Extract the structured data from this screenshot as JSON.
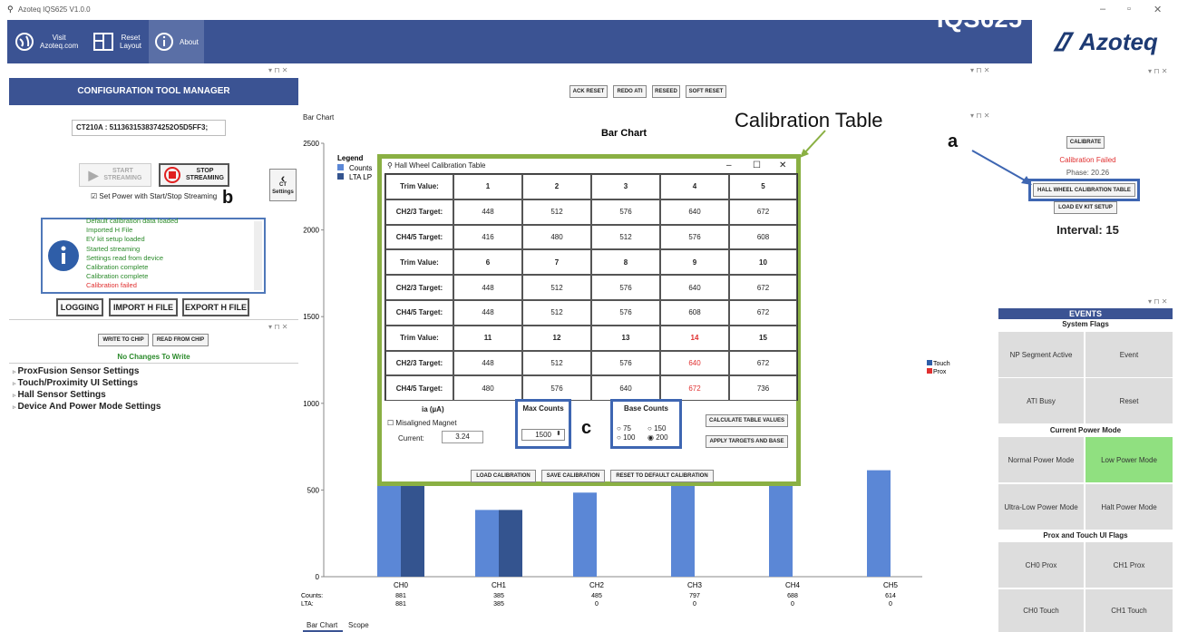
{
  "app": {
    "title": "Azoteq IQS625 V1.0.0",
    "brand": "IQS625",
    "logo": "Azoteq"
  },
  "ribbon": {
    "visit": "Visit\nAzoteq.com",
    "reset": "Reset\nLayout",
    "about": "About"
  },
  "config": {
    "header": "CONFIGURATION TOOL MANAGER",
    "device": "CT210A : 5113631538374252O5D5FF3;",
    "start": "START\nSTREAMING",
    "stop": "STOP\nSTREAMING",
    "power_chk": "Set Power with Start/Stop Streaming",
    "ct_settings": "CT\nSettings",
    "log": [
      "Default calibration data loaded",
      "Imported H File",
      "EV kit setup loaded",
      "Started streaming",
      "Settings read from device",
      "Calibration complete",
      "Calibration complete",
      "Calibration failed"
    ],
    "logging": "LOGGING",
    "import": "IMPORT H FILE",
    "export": "EXPORT H FILE"
  },
  "write": {
    "write": "WRITE TO CHIP",
    "read": "READ FROM CHIP",
    "status": "No Changes To Write",
    "tree": [
      "ProxFusion Sensor Settings",
      "Touch/Proximity UI Settings",
      "Hall Sensor Settings",
      "Device And Power Mode Settings"
    ]
  },
  "center": {
    "buttons": [
      "ACK RESET",
      "REDO ATI",
      "RESEED",
      "SOFT RESET"
    ],
    "tab_label": "Bar Chart",
    "tabs": [
      "Bar Chart",
      "Scope"
    ]
  },
  "chart_data": {
    "type": "bar",
    "title": "Bar Chart",
    "categories": [
      "CH0",
      "CH1",
      "CH2",
      "CH3",
      "CH4",
      "CH5"
    ],
    "ylim": [
      0,
      2500
    ],
    "yticks": [
      0,
      500,
      1000,
      1500,
      2000,
      2500
    ],
    "series": [
      {
        "name": "Counts",
        "values": [
          881,
          385,
          485,
          797,
          688,
          614
        ],
        "color": "#5b87d6"
      },
      {
        "name": "LTA",
        "values": [
          881,
          385,
          0,
          0,
          0,
          0
        ],
        "color": "#34548f"
      }
    ],
    "legend_title": "Legend",
    "legend": [
      "Counts",
      "LTA LP"
    ],
    "right_legend": [
      "Touch",
      "Prox"
    ],
    "row_labels": [
      "Counts:",
      "LTA:"
    ]
  },
  "dialog": {
    "title": "Hall Wheel Calibration Table",
    "rows": [
      [
        "Trim Value:",
        "1",
        "2",
        "3",
        "4",
        "5"
      ],
      [
        "CH2/3 Target:",
        "448",
        "512",
        "576",
        "640",
        "672"
      ],
      [
        "CH4/5 Target:",
        "416",
        "480",
        "512",
        "576",
        "608"
      ],
      [
        "Trim Value:",
        "6",
        "7",
        "8",
        "9",
        "10"
      ],
      [
        "CH2/3 Target:",
        "448",
        "512",
        "576",
        "640",
        "672"
      ],
      [
        "CH4/5 Target:",
        "448",
        "512",
        "576",
        "608",
        "672"
      ],
      [
        "Trim Value:",
        "11",
        "12",
        "13",
        "14",
        "15"
      ],
      [
        "CH2/3 Target:",
        "448",
        "512",
        "576",
        "640",
        "672"
      ],
      [
        "CH4/5 Target:",
        "480",
        "576",
        "640",
        "672",
        "736"
      ]
    ],
    "ia": "ia (µA)",
    "misaligned": "Misaligned Magnet",
    "current_label": "Current:",
    "current": "3.24",
    "max_counts": "Max Counts",
    "max_value": "1500",
    "base_counts": "Base Counts",
    "base_opts": [
      "75",
      "150",
      "100",
      "200"
    ],
    "calc": "CALCULATE TABLE VALUES",
    "apply": "APPLY TARGETS AND BASE",
    "load": "LOAD CALIBRATION",
    "save": "SAVE CALIBRATION",
    "reset": "RESET TO DEFAULT CALIBRATION"
  },
  "right": {
    "calibrate": "CALIBRATE",
    "failed": "Calibration Failed",
    "phase": "Phase: 20.26",
    "hall": "HALL WHEEL CALIBRATION TABLE",
    "load_ev": "LOAD EV KIT SETUP",
    "interval": "Interval: 15"
  },
  "events": {
    "header": "EVENTS",
    "system": "System Flags",
    "sys_items": [
      "NP Segment Active",
      "Event",
      "ATI Busy",
      "Reset"
    ],
    "power": "Current Power Mode",
    "power_items": [
      "Normal Power Mode",
      "Low Power Mode",
      "Ultra-Low Power Mode",
      "Halt Power Mode"
    ],
    "prox": "Prox and Touch UI Flags",
    "prox_items": [
      "CH0 Prox",
      "CH1 Prox",
      "CH0 Touch",
      "CH1 Touch"
    ]
  },
  "annotations": {
    "a": "a",
    "b": "b",
    "c": "c",
    "cal_table": "Calibration Table"
  }
}
